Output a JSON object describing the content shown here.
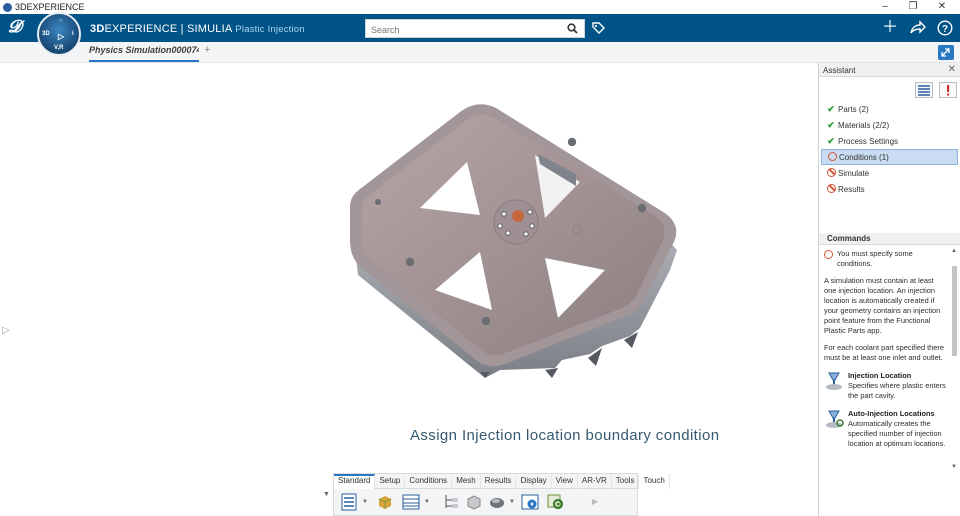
{
  "window": {
    "title": "3DEXPERIENCE"
  },
  "topbar": {
    "brand_prefix": "3D",
    "brand_main": "EXPERIENCE | SIMULIA",
    "app_name": "Plastic Injection",
    "compass_label": "V,R",
    "search_placeholder": "Search"
  },
  "tab": {
    "label": "Physics Simulation000074",
    "add": "+"
  },
  "canvas": {
    "caption": "Assign Injection location boundary condition"
  },
  "toolbar": {
    "tabs": [
      "Standard",
      "Setup",
      "Conditions",
      "Mesh",
      "Results",
      "Display",
      "View",
      "AR-VR",
      "Tools",
      "Touch"
    ],
    "active_tab": "Standard"
  },
  "assistant": {
    "title": "Assistant",
    "steps": [
      {
        "label": "Parts (2)",
        "status": "done"
      },
      {
        "label": "Materials (2/2)",
        "status": "done"
      },
      {
        "label": "Process Settings",
        "status": "done"
      },
      {
        "label": "Conditions (1)",
        "status": "warning",
        "selected": true
      },
      {
        "label": "Simulate",
        "status": "blocked"
      },
      {
        "label": "Results",
        "status": "blocked"
      }
    ],
    "commands_title": "Commands",
    "warning": "You must specify some conditions.",
    "para1": "A simulation must contain at least one injection location. An injection location is automatically created if your geometry contains an injection point feature from the Functional Plastic Parts app.",
    "para2": "For each coolant part specified there must be at least one inlet and outlet.",
    "cmd1_title": "Injection Location",
    "cmd1_desc": "Specifies where plastic enters the part cavity.",
    "cmd2_title": "Auto-Injection Locations",
    "cmd2_desc": "Automatically creates the specified number of injection location at optimum locations."
  },
  "colors": {
    "topbar": "#005386",
    "accent": "#2a78c5",
    "selected_step": "#c9dcf1"
  }
}
